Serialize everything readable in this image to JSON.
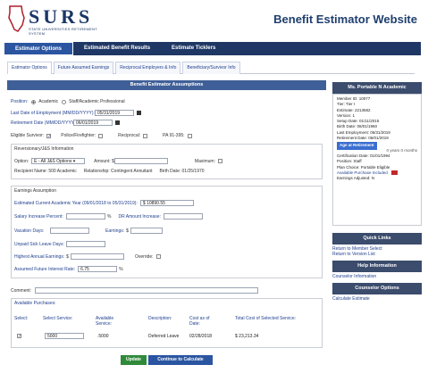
{
  "header": {
    "logo_text": "SURS",
    "logo_sub": "STATE UNIVERSITIES RETIREMENT SYSTEM",
    "site_title": "Benefit Estimator Website"
  },
  "nav": {
    "items": [
      {
        "label": "Estimator Options"
      },
      {
        "label": "Estimated Benefit Results"
      },
      {
        "label": "Estimate Ticklers"
      }
    ]
  },
  "subtabs": [
    {
      "label": "Estimator Options"
    },
    {
      "label": "Future Assumed Earnings"
    },
    {
      "label": "Reciprocal Employers & Info"
    },
    {
      "label": "Beneficiary/Survivor Info"
    }
  ],
  "assumptions": {
    "title": "Benefit Estimator Assumptions",
    "position_label": "Position:",
    "position_options": [
      "Academic",
      "Staff/Academic Professional"
    ],
    "last_employment_label": "Last Date of Employment (MM/DD/YYYY):",
    "last_employment_value": "05/31/2019",
    "retirement_date_label": "Retirement Date (MM/DD/YYYY):",
    "retirement_date_value": "06/01/2019",
    "eligible_survivor_label": "Eligible Survivor:",
    "police_label": "Police/Firefighter:",
    "reciprocal_label": "Reciprocal:",
    "pa_label": "PA 91-395:"
  },
  "reversionary": {
    "title": "Reversionary/J&S Information",
    "option_label": "Option:",
    "option_value": "E - All J&S Options",
    "amount_label": "Amount: $",
    "maximum_label": "Maximum:",
    "recipient_label": "Recipient Name: 500 Academic",
    "relationship_label": "Relationship: Contingent Annuitant",
    "birth_date_label": "Birth Date: 01/25/1970"
  },
  "earnings": {
    "title": "Earnings Assumption",
    "current_year_label": "Estimated Current Academic Year (09/01/2018 to 05/31/2019):",
    "current_year_value": "$ 10890.55",
    "salary_increase_label": "Salary Increase Percent:",
    "dr_amount_label": "DR Amount Increase:",
    "vacation_label": "Vacation Days:",
    "earnings_label": "Earnings:",
    "unpaid_sick_label": "Unpaid Sick Leave Days:",
    "highest_annual_label": "Highest Annual Earnings:",
    "override_label": "Override:",
    "interest_rate_label": "Assumed Future Interest Rate:",
    "interest_rate_value": "6.75",
    "percent_sign": "%",
    "dollar_sign": "$"
  },
  "comment": {
    "label": "Comment:"
  },
  "purchases": {
    "title": "Available Purchases:",
    "headers": [
      "Select:",
      "Select Service:",
      "Available Service:",
      "Description:",
      "Cost as of Date:",
      "Total Cost of Selected Service:"
    ],
    "row": {
      "service": "5000",
      "available": ".5000",
      "description": "Deferred Leave",
      "date": "02/28/2018",
      "total": "$ 23,213.34"
    }
  },
  "buttons": {
    "update": "Update",
    "continue": "Continue to Calculate"
  },
  "sidebar": {
    "member_title": "Ms. Portable N Academic",
    "lines": [
      "Member ID: 10077",
      "Tier: Tier I",
      "Estimate: 2213582",
      "Version: 1",
      "Setup Date: 01/11/2015",
      "Birth Date: 06/01/1960",
      "Last Employment: 05/31/2019",
      "Retirement Date: 06/01/2019"
    ],
    "age_button": "Age at Retirement",
    "age_value": "0 years 0 months",
    "lines2": [
      "Certification Date: 01/01/1994",
      "Position: Staff",
      "Plan Choice: Portable Eligible"
    ],
    "available_purchase": "Available Purchase Included",
    "earnings_adjusted": "Earnings Adjusted: N",
    "quick_links_title": "Quick Links",
    "quick_links": [
      "Return to Member Select",
      "Return to Version List"
    ],
    "help_title": "Help Information",
    "help_links": [
      "Counselor Information"
    ],
    "counselor_title": "Counselor Options",
    "counselor_links": [
      "Calculate Estimate"
    ]
  }
}
